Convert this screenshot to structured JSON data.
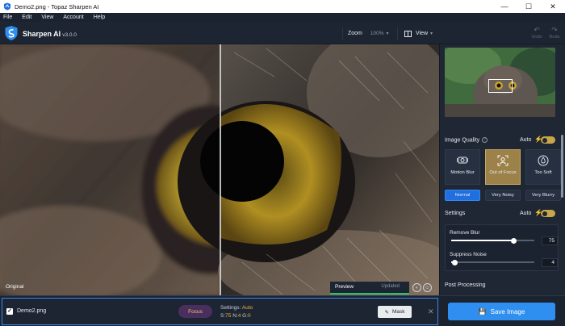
{
  "window": {
    "title": "Demo2.png - Topaz Sharpen AI",
    "controls": {
      "minimize": "—",
      "maximize": "☐",
      "close": "✕"
    }
  },
  "menu": [
    "File",
    "Edit",
    "View",
    "Account",
    "Help"
  ],
  "header": {
    "app_name": "Sharpen AI",
    "version": "v3.0.0",
    "zoom_label": "Zoom",
    "zoom_value": "100%",
    "view_label": "View",
    "undo_label": "Undo",
    "redo_label": "Redo"
  },
  "preview": {
    "original_label": "Original",
    "preview_label": "Preview",
    "status": "Updated",
    "progress": 1.0
  },
  "sidebar": {
    "image_quality": {
      "title": "Image Quality",
      "auto_label": "Auto",
      "auto_on": true,
      "modes": [
        {
          "label": "Motion Blur",
          "icon": "camera-shake-icon",
          "selected": false
        },
        {
          "label": "Out of Focus",
          "icon": "focus-person-icon",
          "selected": true
        },
        {
          "label": "Too Soft",
          "icon": "droplet-icon",
          "selected": false
        }
      ],
      "levels": [
        {
          "label": "Normal",
          "selected": true
        },
        {
          "label": "Very Noisy",
          "selected": false
        },
        {
          "label": "Very Blurry",
          "selected": false
        }
      ]
    },
    "settings": {
      "title": "Settings",
      "auto_label": "Auto",
      "auto_on": true,
      "sliders": [
        {
          "label": "Remove Blur",
          "value": "75",
          "fraction": 0.75
        },
        {
          "label": "Suppress Noise",
          "value": "4",
          "fraction": 0.04
        }
      ]
    },
    "post_processing": {
      "title": "Post Processing"
    }
  },
  "bottom": {
    "file_name": "Demo2.png",
    "mode_pill": "Focus",
    "settings_label": "Settings:",
    "settings_mode": "Auto",
    "s_label": "S:",
    "s_value": "75",
    "n_label": "N:",
    "n_value": "4",
    "g_label": "G:",
    "g_value": "0",
    "mask_label": "Mask",
    "save_label": "Save Image"
  },
  "colors": {
    "accent_blue": "#2f8ff0",
    "gold": "#e8b63a",
    "progress_green": "#2fbf71",
    "panel": "#1f2734"
  }
}
